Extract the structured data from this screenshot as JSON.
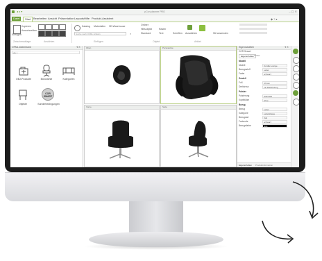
{
  "app": {
    "title": "pCon.planner PRO",
    "tabs": [
      "Datei",
      "Start",
      "Bearbeiten",
      "Ansicht",
      "Präsentation",
      "Layouts",
      "Hilfe",
      "Produkt-Assistent"
    ],
    "active_tab": "Start"
  },
  "ribbon": {
    "groups": [
      {
        "label": "Zwischenablage"
      },
      {
        "label": "Ansichten"
      },
      {
        "label": "Einfügen"
      },
      {
        "label": "Objekt"
      },
      {
        "label": "Artikel"
      }
    ],
    "buttons": [
      "Einfügen",
      "Kopieren",
      "Ausschneiden",
      "Katalog",
      "Materialien",
      "3D-Warehouse",
      "Ordner",
      "Hilfsobjekt",
      "Standard",
      "Raster",
      "Text",
      "Schriften",
      "Auswählen",
      "Stil anwenden"
    ],
    "search_placeholder": "Suche nach OFML Artikeln"
  },
  "left_panel": {
    "title": "OFML-Datenbank",
    "tiles": [
      {
        "label": "OBJ-Produkte",
        "icon": "folder-icon"
      },
      {
        "label": "Bürostühle",
        "icon": "chair-icon"
      },
      {
        "label": "Kategorien",
        "icon": "sofa-icon"
      },
      {
        "label": "Objekte",
        "icon": "chair-icon"
      },
      {
        "label": "Sonderbedingungen",
        "icon": "badge-icon"
      }
    ],
    "badge_text": "COR\nSMART"
  },
  "viewports": [
    {
      "label": "Oben",
      "view": "top"
    },
    {
      "label": "Perspektive",
      "view": "perspective"
    },
    {
      "label": "Vorne",
      "view": "front"
    },
    {
      "label": "Seite",
      "view": "side"
    }
  ],
  "right_panel": {
    "title": "Eigenschaften",
    "subtitle": "COR Sessel",
    "tabs": [
      "Eigenschaften",
      "Artikel"
    ],
    "sections": [
      {
        "name": "Modell",
        "rows": [
          {
            "label": "Modell",
            "value": "Cordia Lounge"
          },
          {
            "label": "Bezugsstoff",
            "value": "Leder"
          },
          {
            "label": "Farbe",
            "value": "schwarz"
          }
        ]
      },
      {
        "name": "Gestell",
        "rows": [
          {
            "label": "Fuß",
            "value": "Chrom"
          },
          {
            "label": "Drehkreuz",
            "value": "mit Rückholung"
          }
        ]
      },
      {
        "name": "Polster",
        "rows": [
          {
            "label": "Polsterung",
            "value": "Standard"
          },
          {
            "label": "Kopfstütze",
            "value": "ohne"
          }
        ]
      },
      {
        "name": "Bezug",
        "rows": [
          {
            "label": "Bezug",
            "value": "Leder"
          },
          {
            "label": "Kategorie",
            "value": "Lederklasse"
          },
          {
            "label": "Bezugsart",
            "value": "Voll"
          },
          {
            "label": "Farbcode",
            "value": "schwarz"
          },
          {
            "label": "Bezugsfarbe",
            "value": "RAL"
          }
        ]
      }
    ],
    "footer_tabs": [
      "Eigenschaften",
      "Produktinformation"
    ]
  },
  "colors": {
    "accent": "#6ea03a",
    "bezel": "#1c1c1c",
    "chair": "#1a1a1a"
  }
}
